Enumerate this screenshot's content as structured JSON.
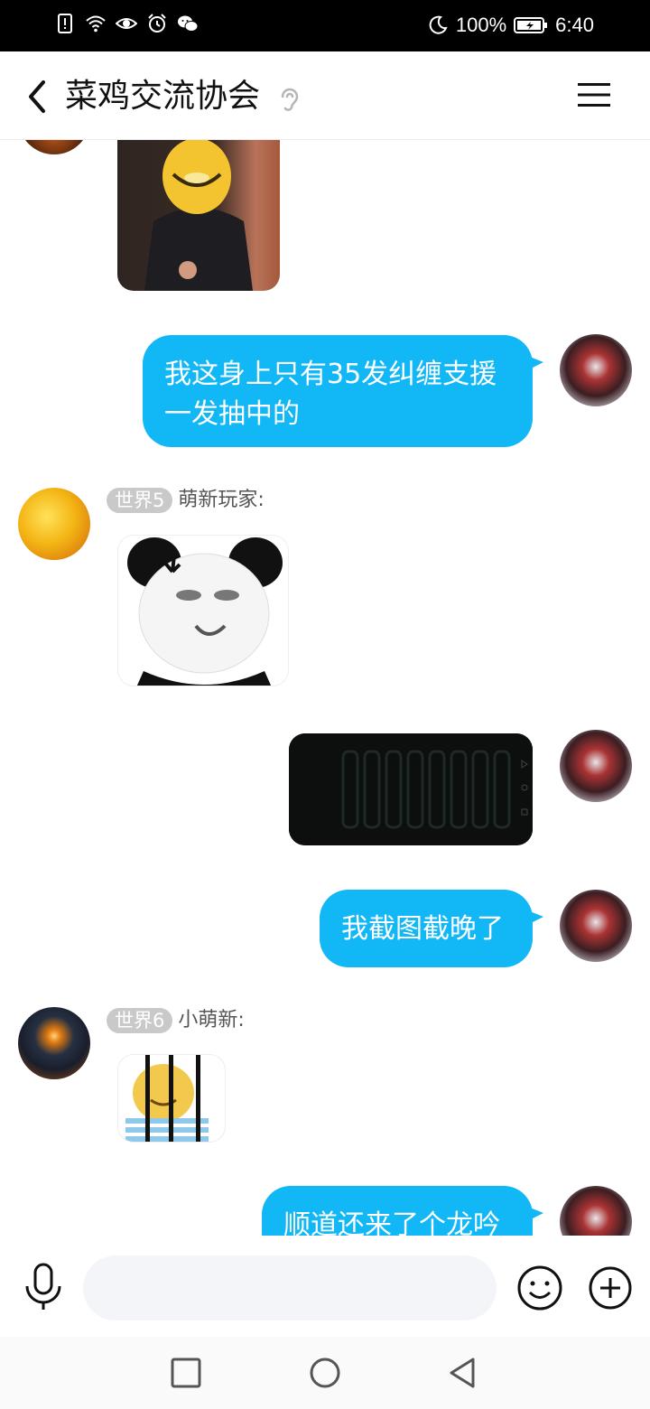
{
  "status_bar": {
    "battery": "100%",
    "time": "6:40",
    "left_icons": [
      "sim-alert-icon",
      "wifi-icon",
      "eye-icon",
      "alarm-icon",
      "wechat-icon"
    ],
    "right_icons": [
      "moon-icon",
      "battery-icon"
    ]
  },
  "header": {
    "title": "菜鸡交流协会",
    "back_icon": "chevron-left-icon",
    "ear_icon": "ear-icon",
    "menu_icon": "hamburger-menu-icon"
  },
  "messages": [
    {
      "type": "image",
      "direction": "in",
      "content": "sticker-person-with-smile-mask"
    },
    {
      "type": "text",
      "direction": "out",
      "lines": [
        "我这身上只有35发纠缠支援",
        "一发抽中的"
      ]
    },
    {
      "type": "image",
      "direction": "in",
      "badge": "世界5",
      "sender": "萌新玩家:",
      "content": "panda-meme-sticker"
    },
    {
      "type": "image",
      "direction": "out",
      "content": "game-screenshot"
    },
    {
      "type": "text",
      "direction": "out",
      "lines": [
        "我截图截晚了"
      ]
    },
    {
      "type": "image",
      "direction": "in",
      "badge": "世界6",
      "sender": "小萌新:",
      "content": "smiley-behind-bars-sticker"
    },
    {
      "type": "text",
      "direction": "out",
      "lines": [
        "顺道还来了个龙吟"
      ]
    }
  ],
  "input_bar": {
    "placeholder": "",
    "icons": [
      "microphone-icon",
      "emoji-icon",
      "plus-icon"
    ]
  },
  "nav_bar": {
    "icons": [
      "recent-apps-icon",
      "home-icon",
      "back-triangle-icon"
    ]
  },
  "colors": {
    "bubble_out": "#12b7f5",
    "badge_bg": "#c9c9c9",
    "status_bar_bg": "#000000"
  }
}
